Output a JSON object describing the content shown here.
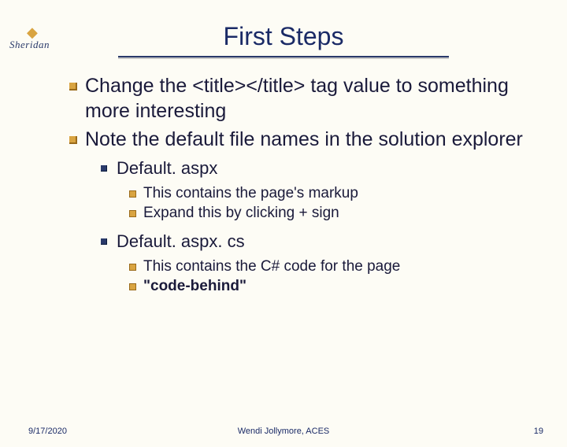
{
  "logo": {
    "text": "Sheridan"
  },
  "title": "First Steps",
  "bullets": {
    "b1": "Change the <title></title> tag value to something more interesting",
    "b2": "Note the default file names in the solution explorer",
    "b2_1": "Default. aspx",
    "b2_1_1": "This contains the page's markup",
    "b2_1_2": "Expand this by clicking + sign",
    "b2_2": "Default. aspx. cs",
    "b2_2_1": "This contains the C# code for the page",
    "b2_2_2": "\"code-behind\""
  },
  "footer": {
    "date": "9/17/2020",
    "author": "Wendi Jollymore, ACES",
    "page": "19"
  }
}
